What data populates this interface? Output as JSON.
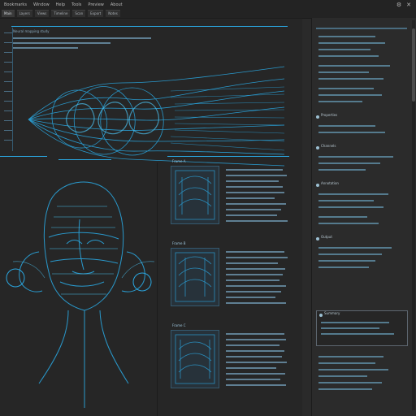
{
  "menu": [
    "Bookmarks",
    "Window",
    "Help",
    "Tools",
    "Preview",
    "About"
  ],
  "tabs": [
    "Main",
    "Layers",
    "Views",
    "Timeline",
    "Scan",
    "Export",
    "Notes"
  ],
  "active_tab": 0,
  "window_controls": {
    "close": "✕",
    "settings": "⚙"
  },
  "main_header": "Neural mapping study",
  "thumbs": [
    "Frame A",
    "Frame B",
    "Frame C"
  ],
  "sidebar_sections": [
    "Properties",
    "Channels",
    "Annotation",
    "Output"
  ],
  "sidebar_note": "Summary",
  "colors": {
    "accent": "#2aa6df",
    "line": "#6a8fa7",
    "bg": "#2a2a2a"
  }
}
